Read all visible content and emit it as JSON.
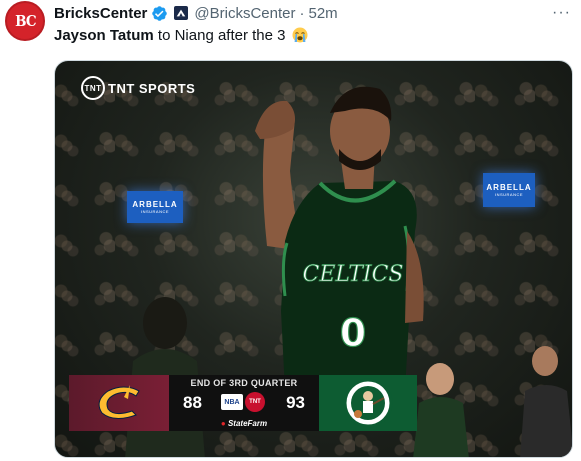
{
  "tweet": {
    "display_name": "BricksCenter",
    "handle": "@BricksCenter",
    "separator": "·",
    "timestamp": "52m",
    "more_label": "···",
    "avatar_text": "BC",
    "text_mention": "Jayson Tatum",
    "text_body": " to Niang after the 3",
    "emoji": "loudly-crying-face"
  },
  "media": {
    "broadcaster": "TNT SPORTS",
    "arena_boards": [
      {
        "brand": "ARBELLA",
        "sub": "INSURANCE"
      },
      {
        "brand": "ARBELLA",
        "sub": "INSURANCE"
      }
    ],
    "jersey_text": "CELTICS",
    "jersey_number": "0",
    "scorebug": {
      "period": "END OF 3RD QUARTER",
      "away_score": "88",
      "home_score": "93",
      "league": "NBA",
      "network": "TNT",
      "sponsor": "StateFarm",
      "away_team": "Cavaliers",
      "home_team": "Celtics"
    }
  },
  "colors": {
    "accent": "#1d9bf0",
    "avatar_bg": "#d4232a",
    "cavs": "#6f1d32",
    "celtics": "#0d5c32",
    "secondary_text": "#536471"
  }
}
